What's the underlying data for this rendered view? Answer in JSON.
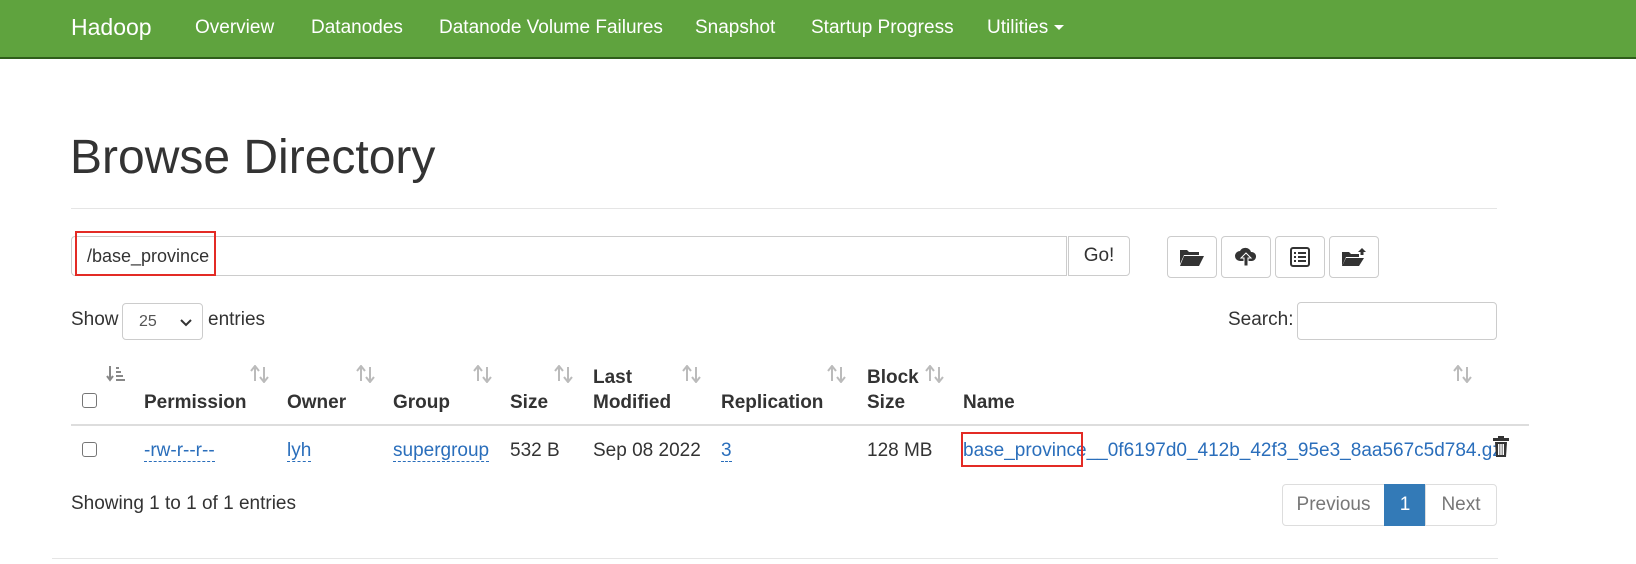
{
  "nav": {
    "brand": "Hadoop",
    "items": [
      "Overview",
      "Datanodes",
      "Datanode Volume Failures",
      "Snapshot",
      "Startup Progress",
      "Utilities"
    ]
  },
  "page": {
    "title": "Browse Directory"
  },
  "toolbar": {
    "path_value": "/base_province",
    "go_label": "Go!",
    "icons": [
      "folder-open-icon",
      "upload-cloud-icon",
      "list-alt-icon",
      "folder-share-icon"
    ]
  },
  "controls": {
    "show_label": "Show",
    "entries_count": "25",
    "entries_label": "entries",
    "search_label": "Search:"
  },
  "table": {
    "columns": [
      "Permission",
      "Owner",
      "Group",
      "Size",
      "Last",
      "Modified",
      "Replication",
      "Block",
      "Size",
      "Name"
    ],
    "rows": [
      {
        "permission": "-rw-r--r--",
        "owner": "lyh",
        "group": "supergroup",
        "size": "532 B",
        "last_modified": "Sep 08 2022",
        "replication": "3",
        "block_size": "128 MB",
        "name": "base_province__0f6197d0_412b_42f3_95e3_8aa567c5d784.gz"
      }
    ]
  },
  "footer": {
    "showing": "Showing 1 to 1 of 1 entries",
    "previous": "Previous",
    "page": "1",
    "next": "Next"
  },
  "colors": {
    "navbar": "#5fa33e",
    "link": "#2a6ebb",
    "highlight": "#e32b25",
    "page_active": "#337ab7"
  }
}
